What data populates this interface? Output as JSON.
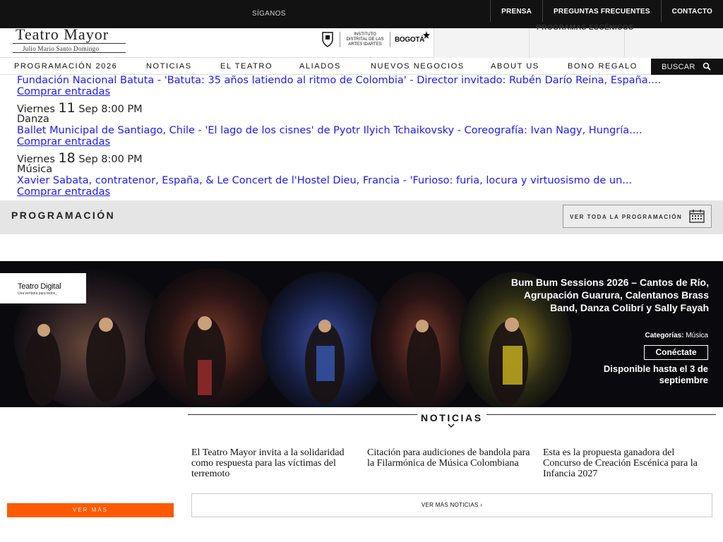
{
  "topbar": {
    "follow_label": "SÍGANOS",
    "links": [
      "PRENSA",
      "PREGUNTAS FRECUENTES",
      "CONTACTO"
    ]
  },
  "logo": {
    "title": "Teatro Mayor",
    "subtitle": "Julio Mario Santo Domingo"
  },
  "sponsors": {
    "idartes": "INSTITUTO DISTRITAL DE LAS ARTES IDARTES",
    "bogota": "BOGOTÁ"
  },
  "header_right": {
    "partial_text": "PROGRAMAS ESCÉNICOS"
  },
  "nav": {
    "items": [
      "PROGRAMACIÓN 2026",
      "NOTICIAS",
      "EL TEATRO",
      "ALIADOS",
      "NUEVOS NEGOCIOS",
      "ABOUT US",
      "BONO REGALO"
    ],
    "search_label": "BUSCAR"
  },
  "events": {
    "first": {
      "title": "Fundación Nacional Batuta - 'Batuta: 35 años latiendo al ritmo de Colombia' - Director invitado: Rubén Darío Reina, España....",
      "buy": "Comprar entradas"
    },
    "second": {
      "weekday": "Viernes",
      "day": "11",
      "rest": "Sep 8:00 PM",
      "category": "Danza",
      "title": "Ballet Municipal de Santiago, Chile - 'El lago de los cisnes' de Pyotr Ilyich Tchaikovsky - Coreografía: Ivan Nagy, Hungría....",
      "buy": "Comprar entradas"
    },
    "third": {
      "weekday": "Viernes",
      "day": "18",
      "rest": "Sep 8:00 PM",
      "category": "Música",
      "title": "Xavier Sabata, contratenor, España, & Le Concert de l'Hostel Dieu, Francia - 'Furioso: furia, locura y virtuosismo de un...",
      "buy": "Comprar entradas"
    }
  },
  "programacion": {
    "title": "PROGRAMACIÓN",
    "button": "VER TODA LA PROGRAMACIÓN"
  },
  "banner": {
    "tag_title": "Teatro Digital",
    "tag_sub": "Una ventana para todos_",
    "title": "Bum Bum Sessions 2026 – Cantos de Río, Agrupación Guarura, Calentanos Brass Band, Danza Colibrí y Sally Fayah",
    "categories_label": "Categorías:",
    "categories_value": "Música",
    "cta": "Conéctate",
    "availability": "Disponible hasta el 3 de septiembre"
  },
  "noticias": {
    "title": "NOTICIAS",
    "items": [
      "El Teatro Mayor invita a la solidaridad como respuesta para las víctimas del terremoto",
      "Citación para audiciones de bandola para la Filarmónica de Música Colombiana",
      "Esta es la propuesta ganadora del Concurso de Creación Escénica para la Infancia 2027"
    ],
    "more_label": "VER MÁS NOTICIAS",
    "ver_mas": "VER MÁS"
  },
  "colors": {
    "topbar": "#121212",
    "link_blue": "#1a1aff",
    "accent_orange": "#ff5a00",
    "strip_gray": "#e5e5e5"
  }
}
